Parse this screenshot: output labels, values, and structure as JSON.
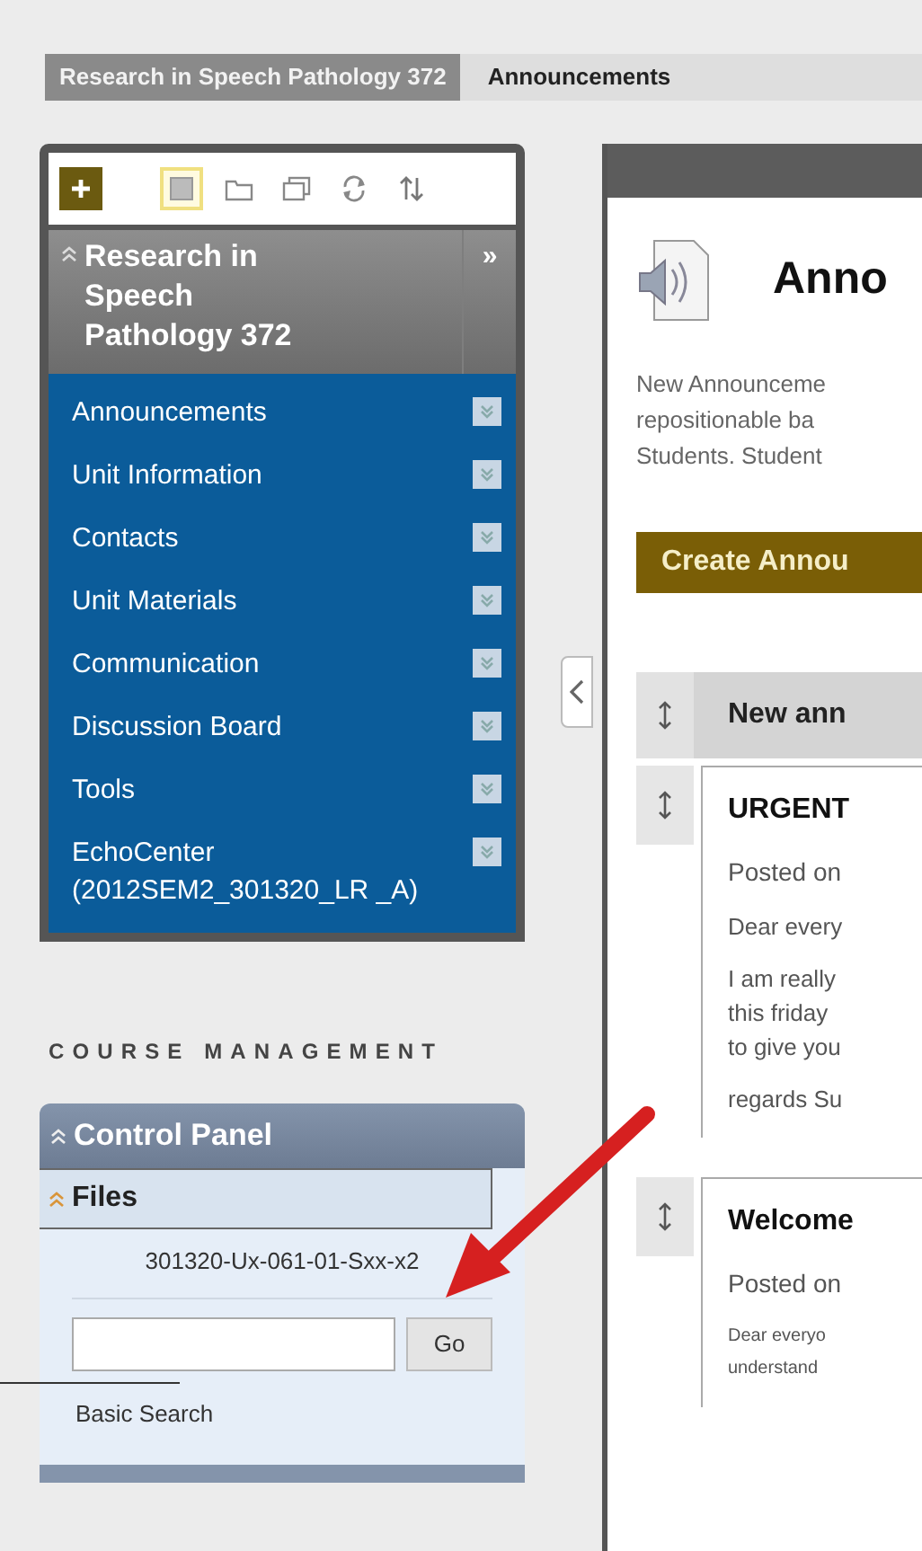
{
  "breadcrumbs": [
    {
      "label": "Research in Speech Pathology 372",
      "selected": false
    },
    {
      "label": "Announcements",
      "selected": true
    }
  ],
  "course_menu": {
    "toolbar": [
      {
        "kind": "add"
      },
      {
        "kind": "list",
        "selected": true
      },
      {
        "kind": "folder",
        "selected": false
      },
      {
        "kind": "windows",
        "selected": false
      },
      {
        "kind": "refresh",
        "selected": false
      },
      {
        "kind": "sort",
        "selected": false
      }
    ],
    "title": "Research in Speech Pathology 372",
    "expand": "»",
    "items": [
      "Announcements",
      "Unit Information",
      "Contacts",
      "Unit Materials",
      "Communication",
      "Discussion Board",
      "Tools",
      "EchoCenter (2012SEM2_301320_LR _A)"
    ]
  },
  "course_management": {
    "heading": "COURSE MANAGEMENT",
    "control_panel": "Control Panel",
    "section": "Files",
    "file": "301320-Ux-061-01-Sxx-x2",
    "search_button": "Go",
    "search_link": "Basic Search"
  },
  "content": {
    "title": "Anno",
    "description": [
      "New Announceme",
      "repositionable ba",
      "Students. Student"
    ],
    "create_button": "Create Annou",
    "column_header": "New ann",
    "announcements": [
      {
        "title": "URGENT",
        "posted": "Posted on",
        "kind": "normal",
        "paragraphs": [
          [
            "Dear every"
          ],
          [
            "I am really",
            "this friday",
            "to give you"
          ],
          [
            "regards Su"
          ]
        ]
      },
      {
        "title": "Welcome",
        "posted": "Posted on",
        "kind": "small",
        "paragraphs": [
          [
            "Dear everyo",
            "understand"
          ]
        ]
      }
    ]
  }
}
